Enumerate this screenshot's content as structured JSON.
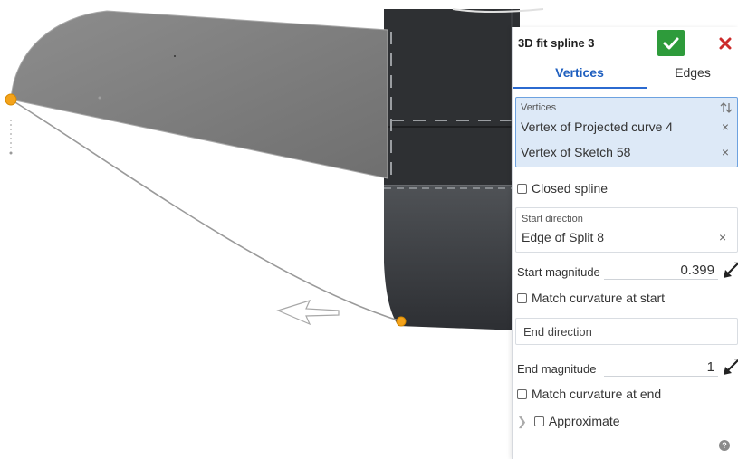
{
  "dialog": {
    "title": "3D fit spline 3",
    "tabs": [
      {
        "label": "Vertices"
      },
      {
        "label": "Edges"
      }
    ],
    "vertices": {
      "label": "Vertices",
      "items": [
        "Vertex of Projected curve 4",
        "Vertex of Sketch 58"
      ]
    },
    "closed_spline_label": "Closed spline",
    "start_direction": {
      "label": "Start direction",
      "value": "Edge of Split 8"
    },
    "start_magnitude": {
      "label": "Start magnitude",
      "value": "0.399"
    },
    "match_curvature_start_label": "Match curvature at start",
    "end_direction": {
      "placeholder": "End direction"
    },
    "end_magnitude": {
      "label": "End magnitude",
      "value": "1"
    },
    "match_curvature_end_label": "Match curvature at end",
    "approximate_label": "Approximate",
    "remove_glyph": "×",
    "help_glyph": "?"
  },
  "colors": {
    "accept": "#2e9b3b",
    "cancel": "#cc2b2b",
    "selected_box": "#dde9f7",
    "selected_border": "#6da2e0",
    "active_tab": "#1f5fbf",
    "vertex_point": "#f4a31b"
  },
  "icons": [
    "checkmark-icon",
    "close-icon",
    "sort-icon",
    "remove-icon",
    "flip-direction-icon",
    "chevron-right-icon",
    "help-icon"
  ]
}
